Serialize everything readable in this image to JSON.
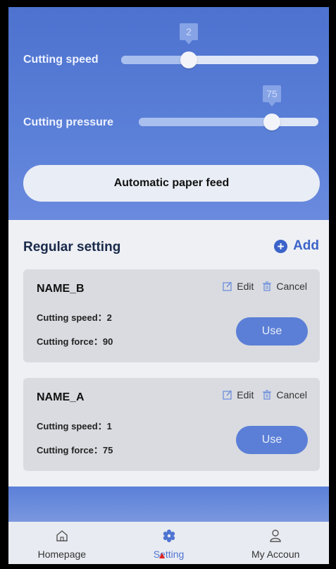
{
  "sliders": {
    "speed": {
      "label": "Cutting speed",
      "value": "2",
      "level": 0.32
    },
    "pressure": {
      "label": "Cutting pressure",
      "value": "75",
      "level": 0.75
    }
  },
  "feed_button": {
    "label": "Automatic paper feed"
  },
  "regular": {
    "title": "Regular setting",
    "add_label": "Add"
  },
  "cards": [
    {
      "name": "NAME_B",
      "edit": "Edit",
      "cancel": "Cancel",
      "speed": "Cutting speed：2",
      "force": "Cutting force：90",
      "use": "Use"
    },
    {
      "name": "NAME_A",
      "edit": "Edit",
      "cancel": "Cancel",
      "speed": "Cutting speed：1",
      "force": "Cutting force：75",
      "use": "Use"
    }
  ],
  "nav": {
    "home": "Homepage",
    "setting": "Setting",
    "account": "My Accoun"
  },
  "colors": {
    "accent": "#4f74d2",
    "header": "#4d72cf"
  }
}
